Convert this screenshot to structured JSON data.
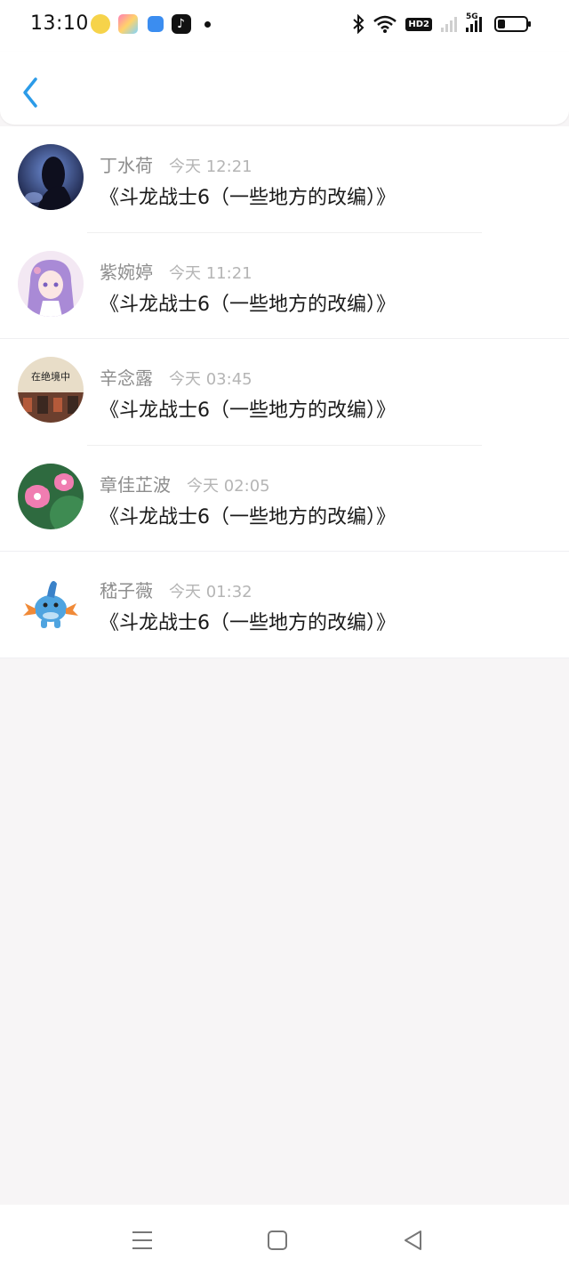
{
  "status_bar": {
    "time": "13:10",
    "notification_icons": [
      "emoji-app-icon",
      "game-app-icon",
      "blue-app-icon",
      "tiktok-icon",
      "more-dot-icon"
    ],
    "system_icons": [
      "bluetooth-icon",
      "wifi-icon",
      "hd-voice-icon",
      "signal-sim1-icon",
      "signal-5g-icon",
      "battery-icon"
    ],
    "hd_label": "HD2",
    "network_label": "5G",
    "battery_level": 0.2
  },
  "header": {
    "back_icon": "chevron-left-icon",
    "accent_color": "#2b9be8"
  },
  "comments": [
    {
      "name": "丁水荷",
      "time": "今天 12:21",
      "message": "《斗龙战士6（一些地方的改编）》"
    },
    {
      "name": "紫婉婷",
      "time": "今天 11:21",
      "message": "《斗龙战士6（一些地方的改编）》"
    },
    {
      "name": "辛念露",
      "time": "今天 03:45",
      "message": "《斗龙战士6（一些地方的改编）》",
      "avatar_text": "在绝境中"
    },
    {
      "name": "章佳芷波",
      "time": "今天 02:05",
      "message": "《斗龙战士6（一些地方的改编）》"
    },
    {
      "name": "嵇子薇",
      "time": "今天 01:32",
      "message": "《斗龙战士6（一些地方的改编）》"
    }
  ],
  "nav_bar": {
    "icons": [
      "menu-icon",
      "home-icon",
      "back-triangle-icon"
    ]
  }
}
